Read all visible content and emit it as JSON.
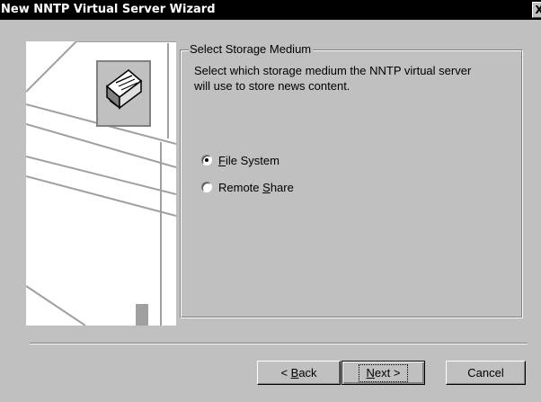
{
  "window": {
    "title": "New NNTP Virtual Server Wizard",
    "close_label": "X"
  },
  "content": {
    "group_title": "Select Storage Medium",
    "description_line1": "Select which storage medium the NNTP virtual server",
    "description_line2": "will use to store news content.",
    "options": [
      {
        "pre": "",
        "accel": "F",
        "post": "ile System",
        "checked": true
      },
      {
        "pre": "Remote ",
        "accel": "S",
        "post": "hare",
        "checked": false
      }
    ]
  },
  "buttons": {
    "back": {
      "pre": "< ",
      "accel": "B",
      "post": "ack"
    },
    "next": {
      "pre": "",
      "accel": "N",
      "post": "ext >"
    },
    "cancel": {
      "label": "Cancel"
    }
  },
  "colors": {
    "face": "#c0c0c0",
    "titlebar": "#000000",
    "shadow": "#808080",
    "highlight": "#ffffff"
  },
  "icons": {
    "wizard_art": "server-news-illustration",
    "art_badge": "newspaper-icon"
  }
}
